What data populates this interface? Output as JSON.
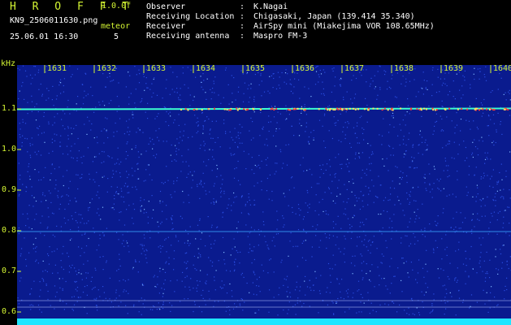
{
  "header": {
    "brand": "H R O F F T",
    "version": "1.0.0f",
    "file_name": "KN9_2506011630.png",
    "meteor_label": "meteor",
    "date_time": "25.06.01 16:30",
    "meteor_count": "5",
    "info": [
      {
        "key": "Observer",
        "value": "K.Nagai"
      },
      {
        "key": "Receiving Location",
        "value": "Chigasaki, Japan (139.414 35.340)"
      },
      {
        "key": "Receiver",
        "value": "AirSpy mini (Miakejima VOR 108.65MHz)"
      },
      {
        "key": "Receiving antenna",
        "value": "Maspro FM-3"
      }
    ]
  },
  "spectrogram": {
    "y_unit": "kHz",
    "y_ticks": [
      "1.1",
      "1.0",
      "0.9",
      "0.8",
      "0.7",
      "0.6"
    ],
    "x_ticks": [
      "1631",
      "1632",
      "1633",
      "1634",
      "1635",
      "1636",
      "1637",
      "1638",
      "1639",
      "1640"
    ],
    "colors": {
      "background": "#0a1b8e",
      "noise_dim": "#2a4de0",
      "noise_bright": "#7fb6ff",
      "carrier_line": "#3cffd0",
      "carrier_hot": "#ff3a3a",
      "baseline_strip": "#1ee6ff",
      "label": "#d4f533"
    }
  }
}
